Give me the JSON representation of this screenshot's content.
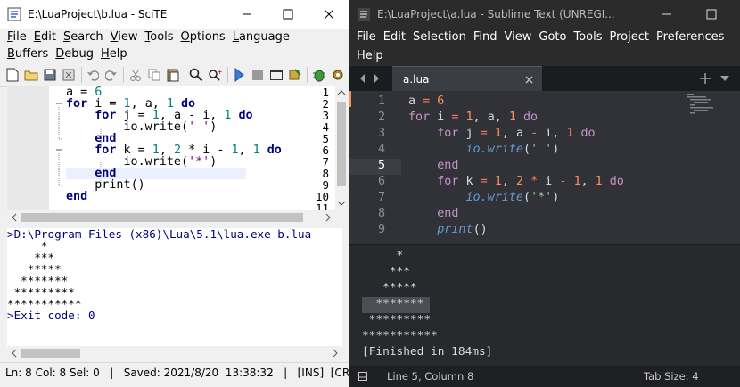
{
  "scite": {
    "title": "E:\\LuaProject\\b.lua - SciTE",
    "menu": [
      "File",
      "Edit",
      "Search",
      "View",
      "Tools",
      "Options",
      "Language",
      "Buffers",
      "Debug",
      "Help"
    ],
    "line_numbers": [
      "1",
      "2",
      "3",
      "4",
      "5",
      "6",
      "7",
      "8",
      "9",
      "10",
      "11"
    ],
    "output_lines": [
      ">D:\\Program Files (x86)\\Lua\\5.1\\lua.exe b.lua",
      "     *",
      "    ***",
      "   *****",
      "  *******",
      " *********",
      "***********",
      ">Exit code: 0"
    ],
    "status": "Ln: 8 Col: 8 Sel: 0   |   Saved: 2021/8/20  13:38:32   |   [INS]  [CR"
  },
  "sublime": {
    "title": "E:\\LuaProject\\a.lua - Sublime Text (UNREGI...",
    "menu": [
      "File",
      "Edit",
      "Selection",
      "Find",
      "View",
      "Goto",
      "Tools",
      "Project",
      "Preferences",
      "Help"
    ],
    "tab_label": "a.lua",
    "line_numbers": [
      "1",
      "2",
      "3",
      "4",
      "5",
      "6",
      "7",
      "8",
      "9"
    ],
    "output_lines": [
      "     *",
      "    ***",
      "   *****",
      "  *******",
      " *********",
      "***********",
      "[Finished in 184ms]"
    ],
    "status_position": "Line 5, Column 8",
    "status_tabsize": "Tab Size: 4"
  },
  "code_tokens": {
    "a": "a",
    "eq": "=",
    "six": "6",
    "for": "for",
    "i": "i",
    "one": "1",
    "do": "do",
    "j": "j",
    "minus": "-",
    "io_write": "io.write",
    "space_str": "' '",
    "end": "end",
    "k": "k",
    "two": "2",
    "star": "*",
    "star_str": "'*'",
    "print": "print"
  },
  "colors": {
    "scite_keyword": "#00007f",
    "scite_number": "#007f7f",
    "scite_string": "#7f007f",
    "sublime_bg": "#303238",
    "sublime_keyword": "#c594c5",
    "sublime_number": "#f99157",
    "sublime_function": "#6699cc",
    "sublime_string": "#99c794"
  }
}
